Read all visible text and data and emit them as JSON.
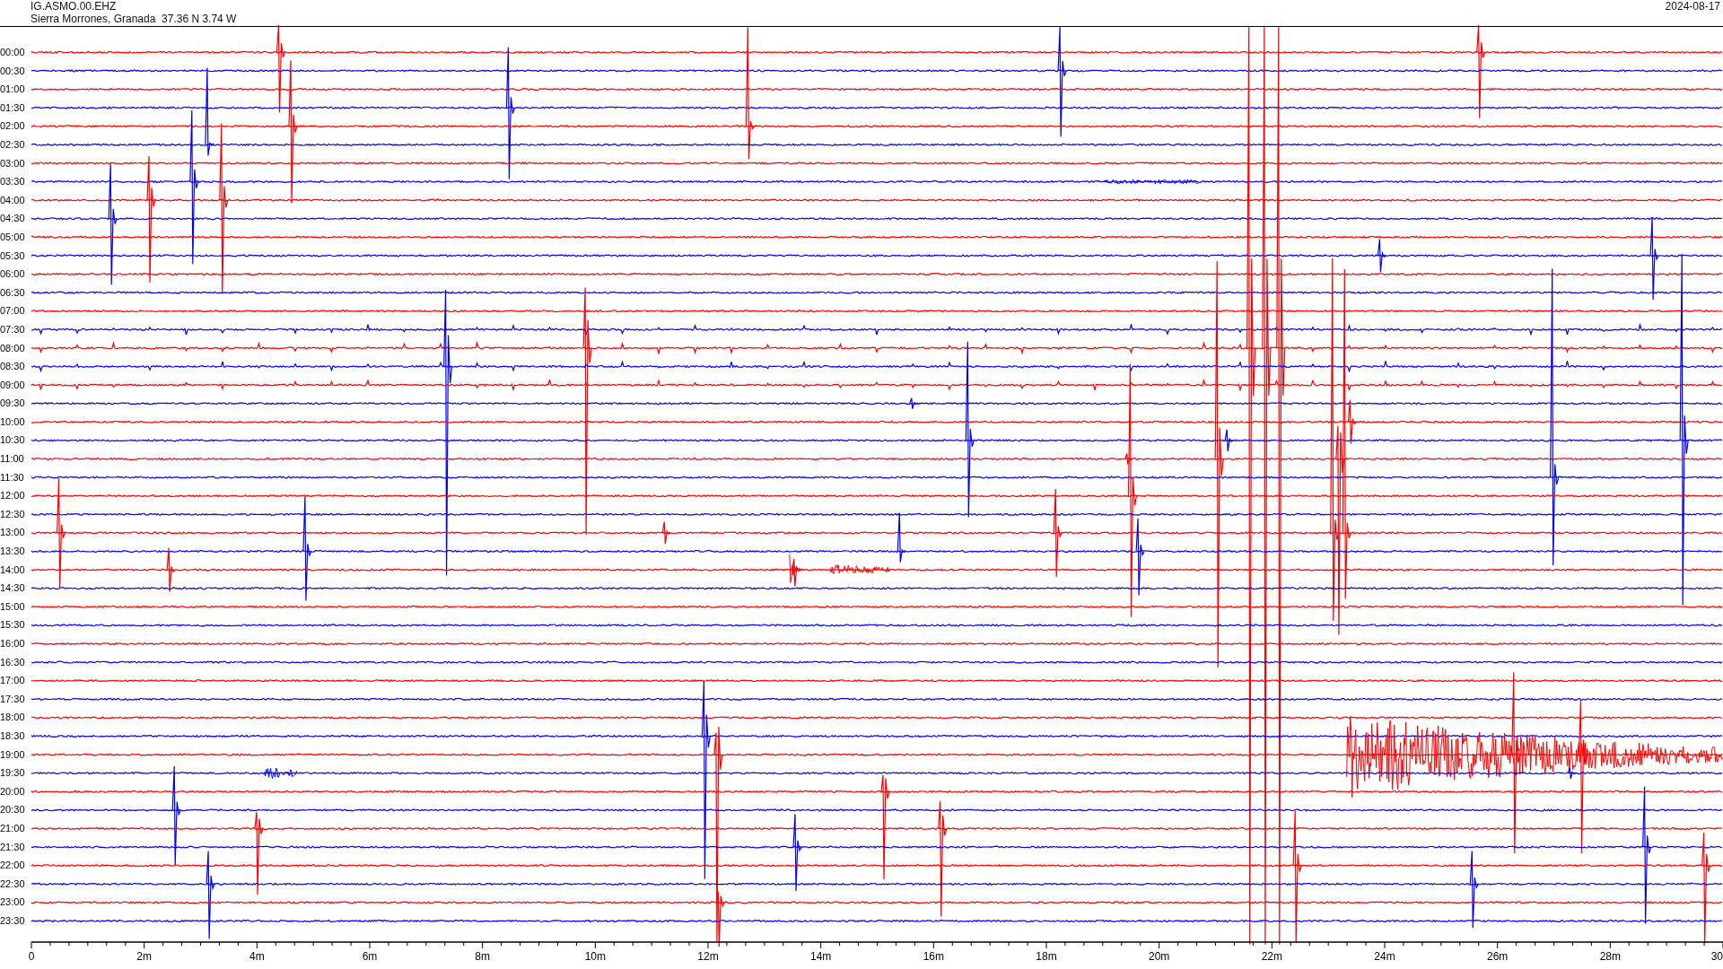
{
  "header": {
    "station": "IG.ASMO.00.EHZ",
    "location": "Sierra Morrones, Granada  37.36 N 3.74 W",
    "date": "2024-08-17"
  },
  "traces": [
    {
      "label": "00:00",
      "color": "#ff0000"
    },
    {
      "label": "00:30",
      "color": "#0000ff"
    },
    {
      "label": "01:00",
      "color": "#ff0000"
    },
    {
      "label": "01:30",
      "color": "#0000ff"
    },
    {
      "label": "02:00",
      "color": "#ff0000"
    },
    {
      "label": "02:30",
      "color": "#0000ff"
    },
    {
      "label": "03:00",
      "color": "#ff0000"
    },
    {
      "label": "03:30",
      "color": "#0000ff"
    },
    {
      "label": "04:00",
      "color": "#ff0000"
    },
    {
      "label": "04:30",
      "color": "#0000ff"
    },
    {
      "label": "05:00",
      "color": "#ff0000"
    },
    {
      "label": "05:30",
      "color": "#0000ff"
    },
    {
      "label": "06:00",
      "color": "#ff0000"
    },
    {
      "label": "06:30",
      "color": "#0000ff"
    },
    {
      "label": "07:00",
      "color": "#ff0000"
    },
    {
      "label": "07:30",
      "color": "#0000ff"
    },
    {
      "label": "08:00",
      "color": "#ff0000"
    },
    {
      "label": "08:30",
      "color": "#0000ff"
    },
    {
      "label": "09:00",
      "color": "#ff0000"
    },
    {
      "label": "09:30",
      "color": "#0000ff"
    },
    {
      "label": "10:00",
      "color": "#ff0000"
    },
    {
      "label": "10:30",
      "color": "#0000ff"
    },
    {
      "label": "11:00",
      "color": "#ff0000"
    },
    {
      "label": "11:30",
      "color": "#0000ff"
    },
    {
      "label": "12:00",
      "color": "#ff0000"
    },
    {
      "label": "12:30",
      "color": "#0000ff"
    },
    {
      "label": "13:00",
      "color": "#ff0000"
    },
    {
      "label": "13:30",
      "color": "#0000ff"
    },
    {
      "label": "14:00",
      "color": "#ff0000"
    },
    {
      "label": "14:30",
      "color": "#0000ff"
    },
    {
      "label": "15:00",
      "color": "#ff0000"
    },
    {
      "label": "15:30",
      "color": "#0000ff"
    },
    {
      "label": "16:00",
      "color": "#ff0000"
    },
    {
      "label": "16:30",
      "color": "#0000ff"
    },
    {
      "label": "17:00",
      "color": "#ff0000"
    },
    {
      "label": "17:30",
      "color": "#0000ff"
    },
    {
      "label": "18:00",
      "color": "#ff0000"
    },
    {
      "label": "18:30",
      "color": "#0000ff"
    },
    {
      "label": "19:00",
      "color": "#ff0000"
    },
    {
      "label": "19:30",
      "color": "#0000ff"
    },
    {
      "label": "20:00",
      "color": "#ff0000"
    },
    {
      "label": "20:30",
      "color": "#0000ff"
    },
    {
      "label": "21:00",
      "color": "#ff0000"
    },
    {
      "label": "21:30",
      "color": "#0000ff"
    },
    {
      "label": "22:00",
      "color": "#ff0000"
    },
    {
      "label": "22:30",
      "color": "#0000ff"
    },
    {
      "label": "23:00",
      "color": "#ff0000"
    },
    {
      "label": "23:30",
      "color": "#0000ff"
    }
  ],
  "x_axis": {
    "ticks": [
      "0",
      "2m",
      "4m",
      "6m",
      "8m",
      "10m",
      "12m",
      "14m",
      "16m",
      "18m",
      "20m",
      "22m",
      "24m",
      "26m",
      "28m",
      "30"
    ]
  }
}
